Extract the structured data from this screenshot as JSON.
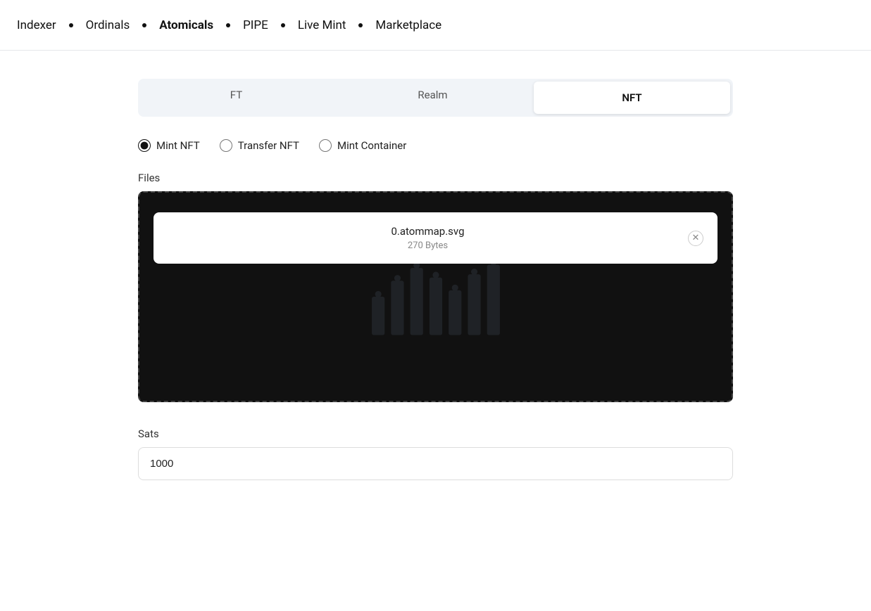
{
  "nav": {
    "items": [
      {
        "label": "Indexer",
        "active": false,
        "id": "indexer"
      },
      {
        "label": "Ordinals",
        "active": false,
        "id": "ordinals"
      },
      {
        "label": "Atomicals",
        "active": true,
        "id": "atomicals"
      },
      {
        "label": "PIPE",
        "active": false,
        "id": "pipe"
      },
      {
        "label": "Live Mint",
        "active": false,
        "id": "live-mint"
      },
      {
        "label": "Marketplace",
        "active": false,
        "id": "marketplace"
      }
    ]
  },
  "tabs": [
    {
      "label": "FT",
      "active": false,
      "id": "ft"
    },
    {
      "label": "Realm",
      "active": false,
      "id": "realm"
    },
    {
      "label": "NFT",
      "active": true,
      "id": "nft"
    }
  ],
  "radio_options": [
    {
      "label": "Mint NFT",
      "value": "mint-nft",
      "checked": true
    },
    {
      "label": "Transfer NFT",
      "value": "transfer-nft",
      "checked": false
    },
    {
      "label": "Mint Container",
      "value": "mint-container",
      "checked": false
    }
  ],
  "files_label": "Files",
  "file": {
    "name": "0.atommap.svg",
    "size": "270 Bytes"
  },
  "sats_label": "Sats",
  "sats_value": "1000"
}
